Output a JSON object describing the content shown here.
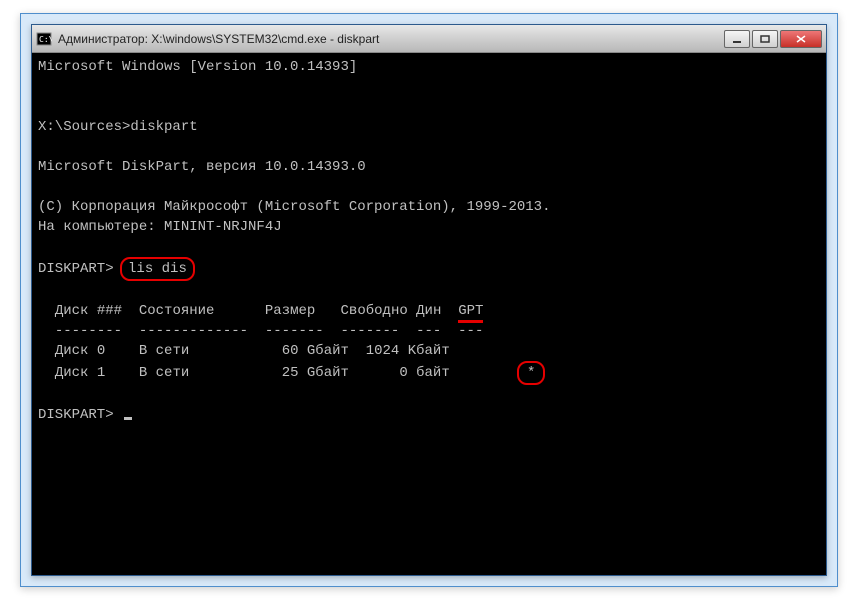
{
  "window": {
    "title": "Администратор: X:\\windows\\SYSTEM32\\cmd.exe - diskpart"
  },
  "terminal": {
    "line_version": "Microsoft Windows [Version 10.0.14393]",
    "prompt1_path": "X:\\Sources>",
    "prompt1_cmd": "diskpart",
    "dp_header": "Microsoft DiskPart, версия 10.0.14393.0",
    "dp_copyright": "(C) Корпорация Майкрософт (Microsoft Corporation), 1999-2013.",
    "dp_computer": "На компьютере: MININT-NRJNF4J",
    "dp_prompt": "DISKPART>",
    "dp_cmd": "lis dis",
    "table": {
      "header": {
        "disk": "Диск ###",
        "state": "Состояние",
        "size": "Размер",
        "free": "Свободно",
        "dyn": "Дин",
        "gpt": "GPT"
      },
      "separator": {
        "disk": "--------",
        "state": "-------------",
        "size": "-------",
        "free": "-------",
        "dyn": "---",
        "gpt": "---"
      },
      "rows": [
        {
          "disk": "Диск 0",
          "state": "В сети",
          "size": "60 Gбайт",
          "free": "1024 Kбайт",
          "dyn": "",
          "gpt": ""
        },
        {
          "disk": "Диск 1",
          "state": "В сети",
          "size": "25 Gбайт",
          "free": "0 байт",
          "dyn": "",
          "gpt": "*"
        }
      ]
    }
  }
}
